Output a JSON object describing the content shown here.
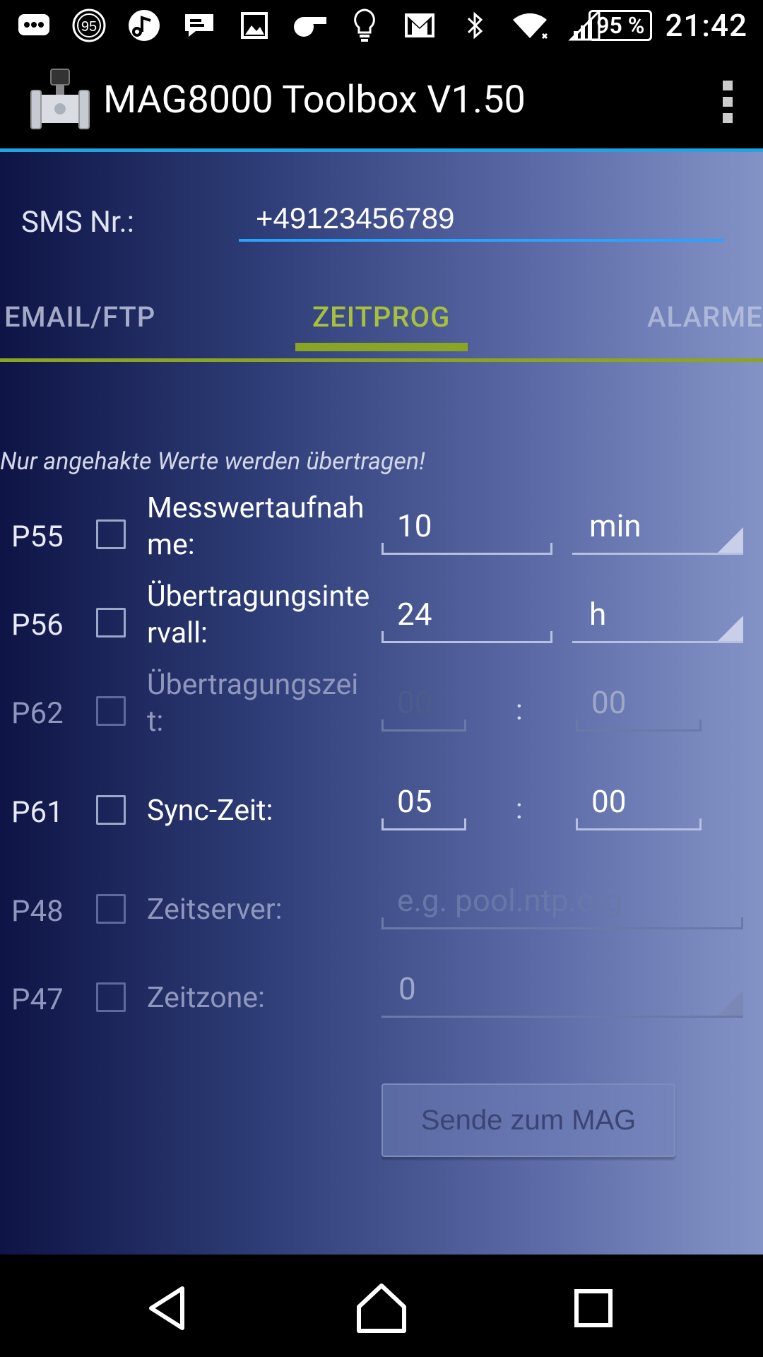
{
  "status_bar": {
    "icons": [
      "messages-icon",
      "badge-95-icon",
      "music-icon",
      "chat-icon",
      "image-icon",
      "whistle-icon",
      "bulb-icon",
      "gmail-icon",
      "bluetooth-icon",
      "wifi-icon",
      "signal-icon"
    ],
    "badge_number": "95",
    "battery": "95 %",
    "time": "21:42"
  },
  "app_bar": {
    "title": "MAG8000 Toolbox V1.50"
  },
  "sms": {
    "label": "SMS Nr.:",
    "value": "+49123456789"
  },
  "tabs": [
    {
      "label": "EMAIL/FTP"
    },
    {
      "label": "ZEITPROG",
      "active": true
    },
    {
      "label": "ALARME"
    }
  ],
  "hint": "Nur angehakte Werte werden übertragen!",
  "params": [
    {
      "code": "P55",
      "label": "Messwertaufnahme:",
      "value": "10",
      "unit": "min",
      "enabled": true
    },
    {
      "code": "P56",
      "label": "Übertragungsintervall:",
      "value": "24",
      "unit": "h",
      "enabled": true
    },
    {
      "code": "P62",
      "label": "Übertragungszeit:",
      "hours": "00",
      "minutes": "00",
      "separator": ":",
      "enabled": false
    },
    {
      "code": "P61",
      "label": "Sync-Zeit:",
      "hours": "05",
      "minutes": "00",
      "separator": ":",
      "enabled": true
    },
    {
      "code": "P48",
      "label": "Zeitserver:",
      "placeholder": "e.g. pool.ntp.org",
      "enabled": false
    },
    {
      "code": "P47",
      "label": "Zeitzone:",
      "value": "0",
      "enabled": false
    }
  ],
  "send_button": "Sende zum MAG",
  "colors": {
    "accent_blue": "#1fa3e1",
    "tab_green": "#8aa521",
    "gradient_start": "#0e1445",
    "gradient_end": "#8493c6"
  }
}
